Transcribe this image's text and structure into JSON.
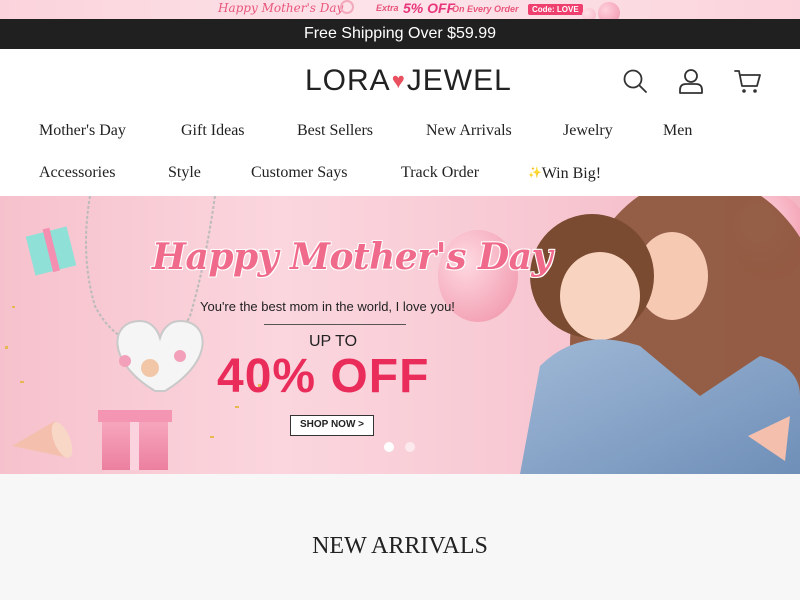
{
  "promo": {
    "script": "Happy Mother's Day",
    "extra": "Extra",
    "percent_off": "5% OFF",
    "every_order": "On Every Order",
    "code": "Code: LOVE"
  },
  "shipping": {
    "text": "Free Shipping Over $59.99"
  },
  "header": {
    "logo_left": "LORA",
    "logo_right": "JEWEL",
    "icons": [
      "search-icon",
      "account-icon",
      "cart-icon"
    ]
  },
  "nav": {
    "row1": [
      "Mother's Day",
      "Gift Ideas",
      "Best Sellers",
      "New Arrivals",
      "Jewelry",
      "Men"
    ],
    "row2": [
      "Accessories",
      "Style",
      "Customer Says",
      "Track Order",
      "Win Big!"
    ]
  },
  "hero": {
    "title": "Happy Mother's Day",
    "subtitle": "You're the best mom in the world, I love you!",
    "upto": "UP TO",
    "discount": "40% OFF",
    "cta": "SHOP NOW >",
    "slides": 2,
    "active_slide": 1
  },
  "section": {
    "title": "NEW ARRIVALS"
  },
  "colors": {
    "accent": "#ea2c5b",
    "logo_heart": "#ea5160",
    "dark_bar": "#202020",
    "hero_bg": "#f8cbd5"
  }
}
